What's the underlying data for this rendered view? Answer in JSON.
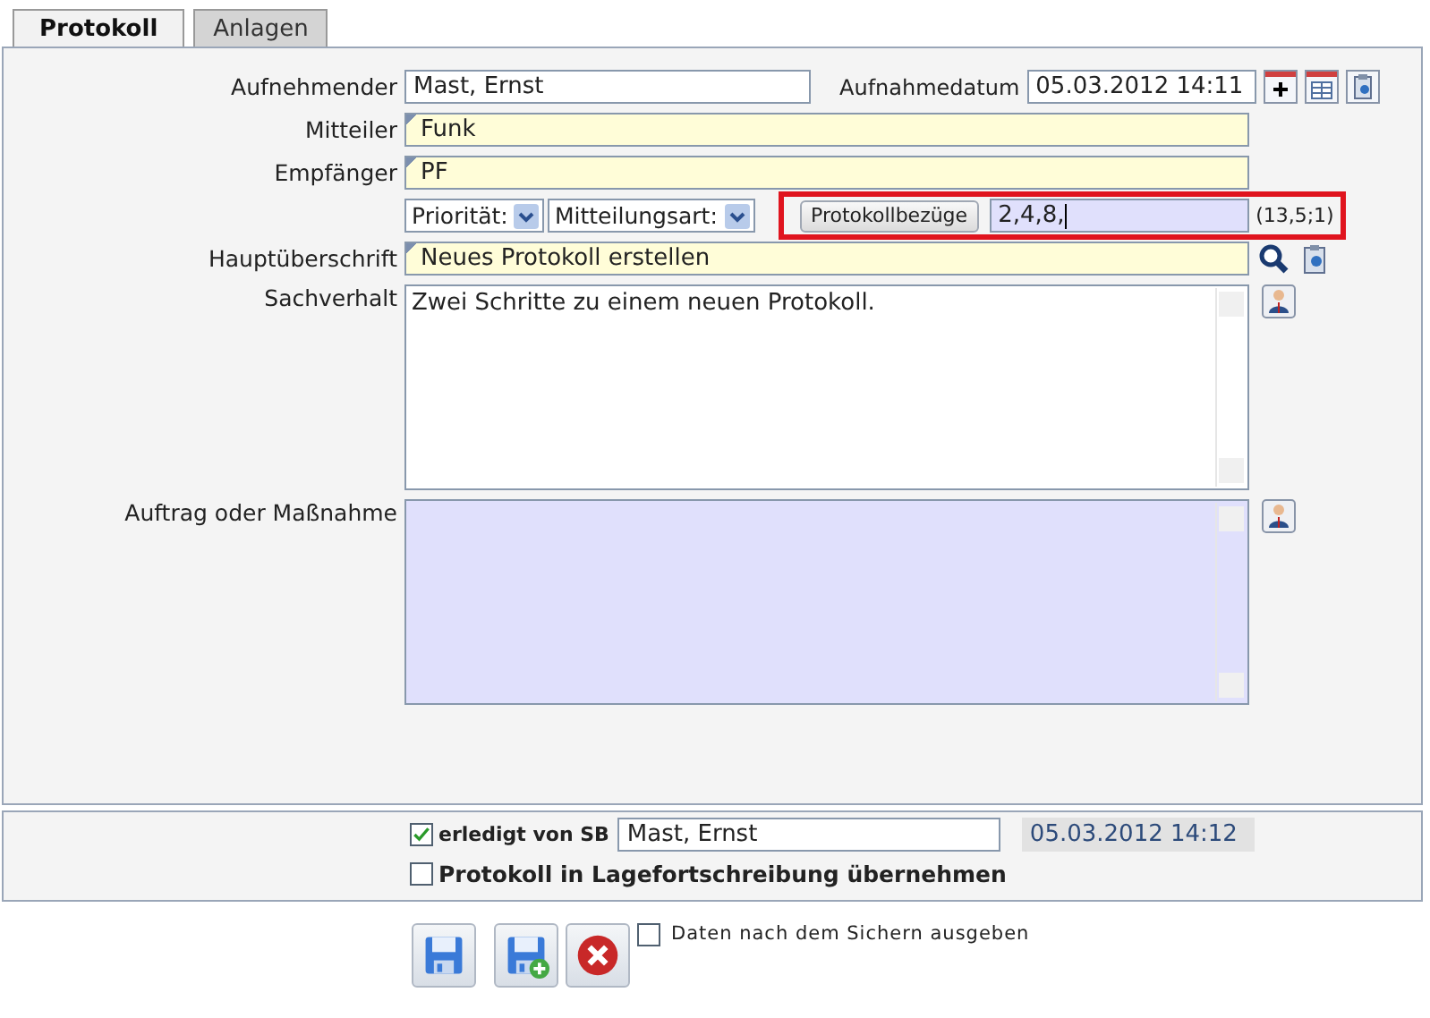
{
  "tabs": [
    {
      "label": "Protokoll",
      "selected": true
    },
    {
      "label": "Anlagen",
      "selected": false
    }
  ],
  "form": {
    "recorder": {
      "label": "Aufnehmender",
      "value": "Mast, Ernst",
      "marked": false
    },
    "record_date": {
      "label": "Aufnahmedatum",
      "value": "05.03.2012 14:11"
    },
    "sender": {
      "label": "Mitteiler",
      "value": "Funk",
      "marked": true
    },
    "recipient": {
      "label": "Empfänger",
      "value": "PF",
      "marked": true
    },
    "priority": {
      "label": "Priorität:"
    },
    "message_type": {
      "label": "Mitteilungsart:"
    },
    "references": {
      "button": "Protokollbezüge",
      "value": "2,4,8,",
      "hint": "(13,5;1)",
      "highlighted": true
    },
    "headline": {
      "label": "Hauptüberschrift",
      "value": "Neues Protokoll erstellen",
      "marked": true
    },
    "facts": {
      "label": "Sachverhalt",
      "value": "Zwei Schritte zu einem neuen Protokoll."
    },
    "order": {
      "label": "Auftrag oder Maßnahme"
    }
  },
  "completion": {
    "done": {
      "checked": true,
      "label": "erledigt von SB",
      "value": "Mast, Ernst",
      "date": "05.03.2012 14:12"
    },
    "transfer": {
      "checked": false,
      "label": "Protokoll in Lagefortschreibung übernehmen"
    }
  },
  "actions": [
    {
      "kind": "save"
    },
    {
      "kind": "save_new"
    },
    {
      "kind": "cancel"
    }
  ],
  "print_after_save": {
    "checked": false,
    "label": "Daten nach dem Sichern ausgeben"
  }
}
